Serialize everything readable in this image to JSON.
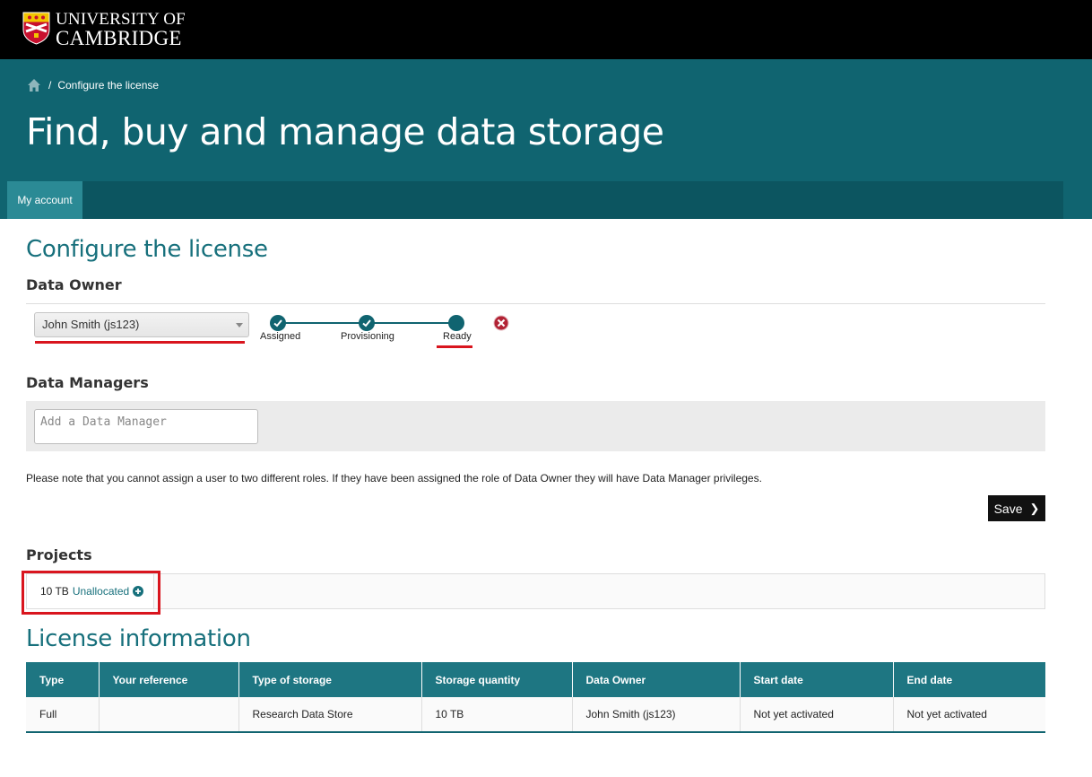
{
  "branding": {
    "line1": "UNIVERSITY OF",
    "line2": "CAMBRIDGE",
    "logo": "cambridge-crest-icon"
  },
  "breadcrumb": {
    "home_icon": "home-icon",
    "separator": "/",
    "current": "Configure the license"
  },
  "page_title": "Find, buy and manage data storage",
  "nav": {
    "tabs": [
      {
        "label": "My account",
        "active": true
      }
    ]
  },
  "configure": {
    "heading": "Configure the license",
    "data_owner_heading": "Data Owner",
    "owner_select": {
      "value": "John Smith (js123)"
    },
    "status_steps": [
      {
        "label": "Assigned",
        "state": "complete"
      },
      {
        "label": "Provisioning",
        "state": "complete"
      },
      {
        "label": "Ready",
        "state": "current"
      }
    ],
    "cancel_icon": "close-circle-icon",
    "data_managers_heading": "Data Managers",
    "manager_input": {
      "placeholder": "Add a Data Manager",
      "value": ""
    },
    "note": "Please note that you cannot assign a user to two different roles. If they have been assigned the role of Data Owner they will have Data Manager privileges.",
    "save_label": "Save"
  },
  "projects": {
    "heading": "Projects",
    "chip": {
      "size": "10 TB",
      "status": "Unallocated",
      "icon": "plus-circle-icon"
    }
  },
  "license_info": {
    "heading": "License information",
    "columns": [
      "Type",
      "Your reference",
      "Type of storage",
      "Storage quantity",
      "Data Owner",
      "Start date",
      "End date"
    ],
    "rows": [
      [
        "Full",
        "",
        "Research Data Store",
        "10 TB",
        "John Smith (js123)",
        "Not yet activated",
        "Not yet activated"
      ]
    ]
  },
  "colors": {
    "teal": "#106470",
    "nav_dark": "#0c5560",
    "nav_active": "#2b8a95",
    "highlight_red": "#d9151e"
  }
}
